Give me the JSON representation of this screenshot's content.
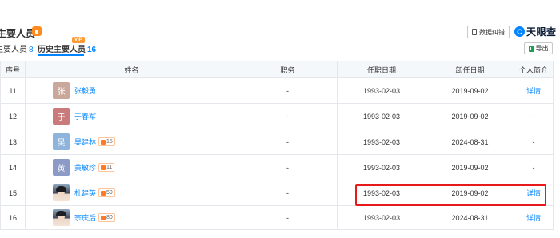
{
  "header": {
    "title": "主要人员",
    "tabs": [
      {
        "label": "主要人员",
        "count": "8"
      },
      {
        "label": "历史主要人员",
        "count": "16"
      }
    ],
    "vip_badge": "VIP",
    "correct_button": "数据纠错",
    "logo_glyph": "C",
    "logo_text": "天眼查",
    "export_button": "导出"
  },
  "table": {
    "columns": [
      "序号",
      "姓名",
      "职务",
      "任职日期",
      "卸任日期",
      "个人简介"
    ],
    "rows": [
      {
        "index": "11",
        "avatar": "张",
        "avatar_color": "#c9a79a",
        "name": "张毅勇",
        "tag": "",
        "position": "-",
        "start": "1993-02-03",
        "end": "2019-09-02",
        "profile": "详情"
      },
      {
        "index": "12",
        "avatar": "于",
        "avatar_color": "#c97b7b",
        "name": "于春军",
        "tag": "",
        "position": "-",
        "start": "1993-02-03",
        "end": "2019-09-02",
        "profile": "-"
      },
      {
        "index": "13",
        "avatar": "吴",
        "avatar_color": "#8eb4db",
        "name": "吴建林",
        "tag": "15",
        "position": "-",
        "start": "1993-02-03",
        "end": "2024-08-31",
        "profile": "-"
      },
      {
        "index": "14",
        "avatar": "黄",
        "avatar_color": "#8c9ac6",
        "name": "黄敏珍",
        "tag": "11",
        "position": "-",
        "start": "1993-02-03",
        "end": "2019-09-02",
        "profile": "-"
      },
      {
        "index": "15",
        "avatar": "",
        "avatar_color": "photo",
        "name": "杜建英",
        "tag": "59",
        "position": "-",
        "start": "1993-02-03",
        "end": "2019-09-02",
        "profile": "详情"
      },
      {
        "index": "16",
        "avatar": "",
        "avatar_color": "photo",
        "name": "宗庆后",
        "tag": "80",
        "position": "-",
        "start": "1993-02-03",
        "end": "2024-08-31",
        "profile": "详情"
      }
    ]
  },
  "colors": {
    "link": "#0084ff",
    "highlight": "#e8191b",
    "accent": "#ff8a1f"
  }
}
